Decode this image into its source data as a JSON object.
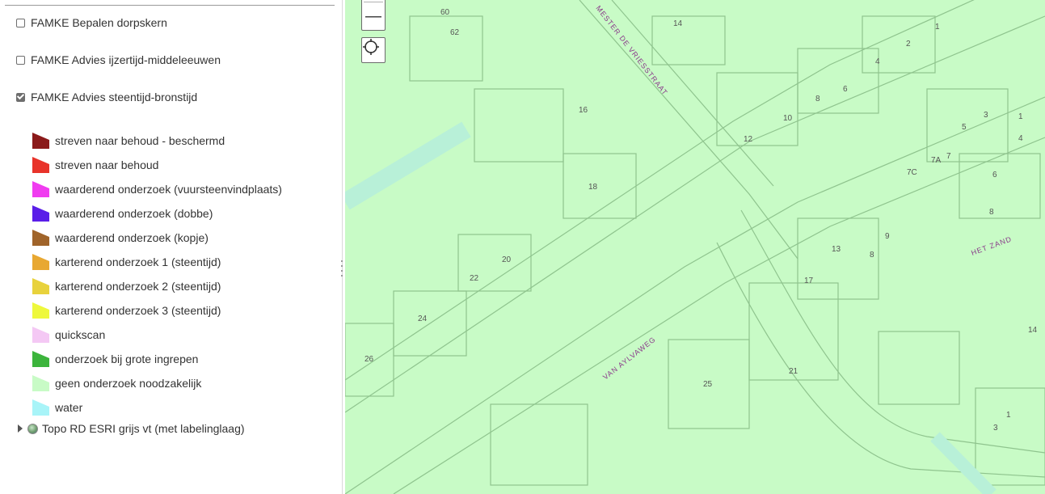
{
  "layers": [
    {
      "label": "FAMKE Bepalen dorpskern",
      "checked": false
    },
    {
      "label": "FAMKE Advies ijzertijd-middeleeuwen",
      "checked": false
    },
    {
      "label": "FAMKE Advies steentijd-bronstijd",
      "checked": true
    }
  ],
  "legend": [
    {
      "label": "streven naar behoud - beschermd",
      "color": "#8b1a1a"
    },
    {
      "label": "streven naar behoud",
      "color": "#e8332a"
    },
    {
      "label": "waarderend onderzoek (vuursteenvindplaats)",
      "color": "#f03cf0"
    },
    {
      "label": "waarderend onderzoek (dobbe)",
      "color": "#5a1ee8"
    },
    {
      "label": "waarderend onderzoek (kopje)",
      "color": "#a0642a"
    },
    {
      "label": "karterend onderzoek 1 (steentijd)",
      "color": "#e8a832"
    },
    {
      "label": "karterend onderzoek 2 (steentijd)",
      "color": "#e8d23c"
    },
    {
      "label": "karterend onderzoek 3 (steentijd)",
      "color": "#eef83c"
    },
    {
      "label": "quickscan",
      "color": "#f4c8f4"
    },
    {
      "label": "onderzoek bij grote ingrepen",
      "color": "#3cb43c"
    },
    {
      "label": "geen onderzoek noodzakelijk",
      "color": "#c8fbc6"
    },
    {
      "label": "water",
      "color": "#a8f4f8"
    }
  ],
  "basemap": {
    "label": "Topo RD ESRI grijs vt (met labelinglaag)"
  },
  "map": {
    "background": "#c8fbc6",
    "streets": [
      {
        "name": "MESTER DE VRIESSTRAAT"
      },
      {
        "name": "VAN AYLVAWEG"
      },
      {
        "name": "HET ZAND"
      }
    ],
    "house_numbers": [
      "60",
      "62",
      "14",
      "1",
      "2",
      "4",
      "6",
      "8",
      "10",
      "12",
      "16",
      "18",
      "20",
      "22",
      "24",
      "26",
      "25",
      "21",
      "17",
      "13",
      "8",
      "9",
      "5",
      "3",
      "1",
      "4",
      "6",
      "8",
      "7",
      "7A",
      "7C",
      "14",
      "3",
      "1"
    ]
  },
  "controls": {
    "zoom_out_symbol": "—"
  }
}
